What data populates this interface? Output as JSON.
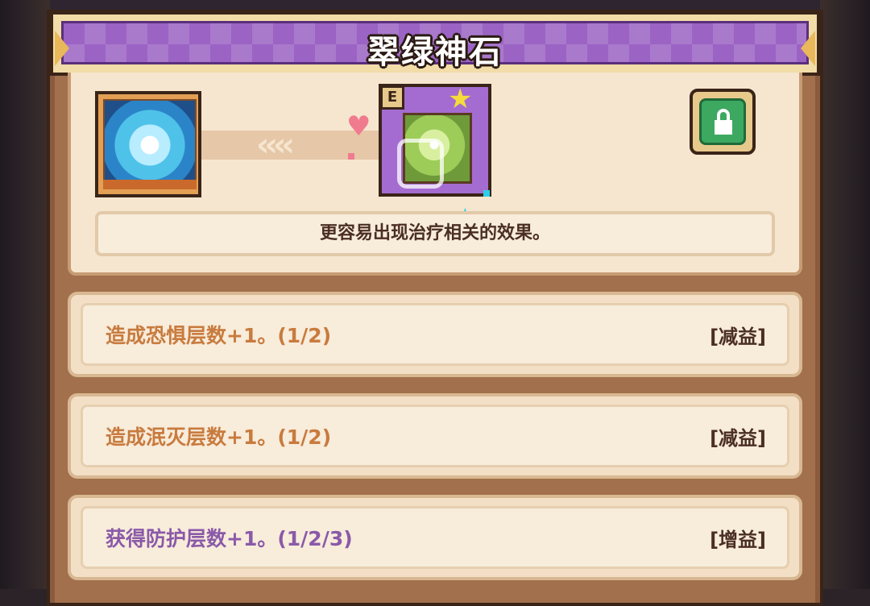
{
  "dialog": {
    "title": "翠绿神石",
    "relic_tag": "E",
    "description": "更容易出现治疗相关的效果。"
  },
  "options": [
    {
      "text": "造成恐惧层数+1。(1/2)",
      "tag": "[减益]",
      "color": "#c87b3e"
    },
    {
      "text": "造成泯灭层数+1。(1/2)",
      "tag": "[减益]",
      "color": "#c87b3e"
    },
    {
      "text": "获得防护层数+1。(1/2/3)",
      "tag": "[增益]",
      "color": "#8a5aa8"
    }
  ],
  "icons": {
    "portrait": "character-portrait",
    "relic": "emerald-relic-icon",
    "lock": "lock-icon",
    "heart": "heart-icon",
    "arrows": "chevron-left-icon"
  },
  "colors": {
    "title_purple": "#9b63c4",
    "debuff_text": "#c87b3e",
    "buff_text": "#8a5aa8",
    "lock_green": "#3da860"
  }
}
